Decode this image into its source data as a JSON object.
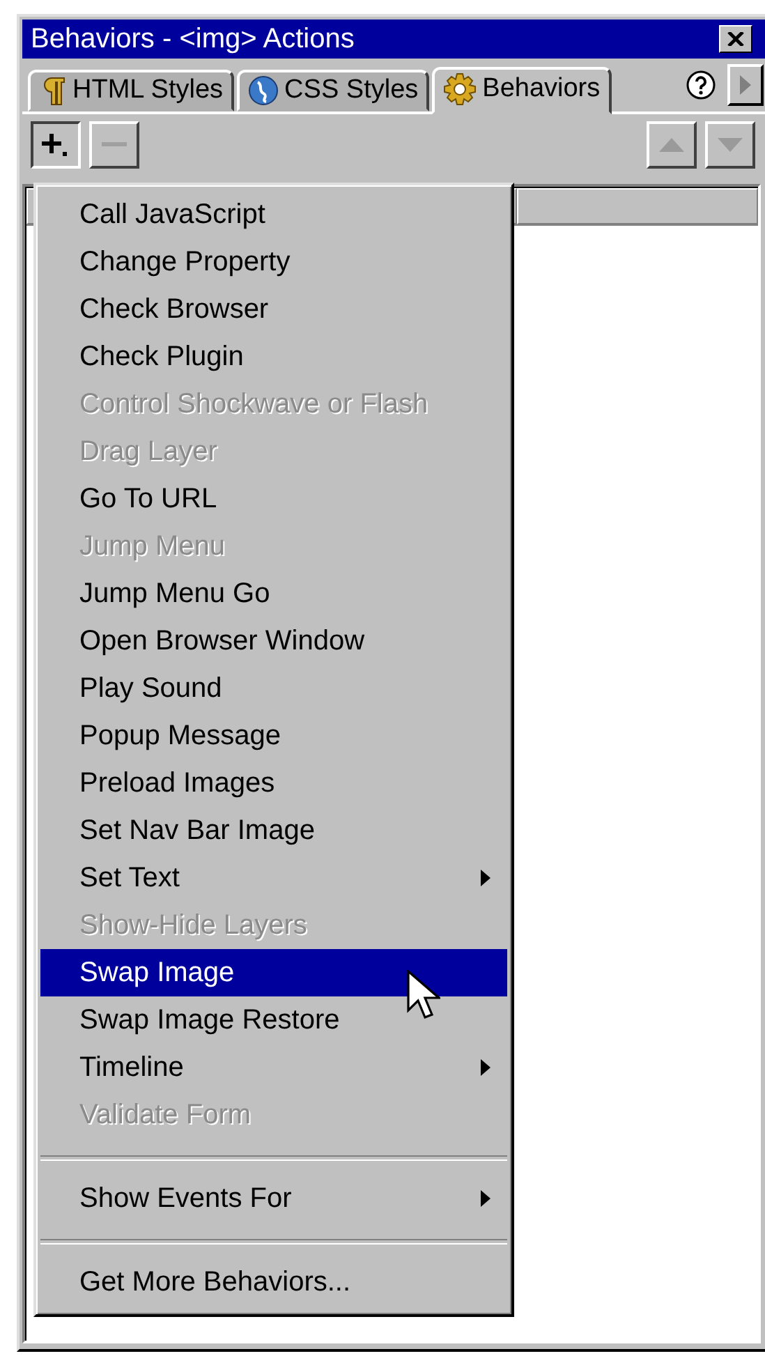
{
  "window": {
    "title": "Behaviors - <img> Actions"
  },
  "tabs": [
    {
      "label": "HTML Styles",
      "selected": false
    },
    {
      "label": "CSS Styles",
      "selected": false
    },
    {
      "label": "Behaviors",
      "selected": true
    }
  ],
  "toolbar": {
    "add": {
      "disabled": false
    },
    "remove": {
      "disabled": true
    },
    "move_up": {
      "disabled": true
    },
    "move_down": {
      "disabled": true
    }
  },
  "menu": {
    "groups": [
      [
        {
          "label": "Call JavaScript",
          "disabled": false,
          "submenu": false,
          "selected": false
        },
        {
          "label": "Change Property",
          "disabled": false,
          "submenu": false,
          "selected": false
        },
        {
          "label": "Check Browser",
          "disabled": false,
          "submenu": false,
          "selected": false
        },
        {
          "label": "Check Plugin",
          "disabled": false,
          "submenu": false,
          "selected": false
        },
        {
          "label": "Control Shockwave or Flash",
          "disabled": true,
          "submenu": false,
          "selected": false
        },
        {
          "label": "Drag Layer",
          "disabled": true,
          "submenu": false,
          "selected": false
        },
        {
          "label": "Go To URL",
          "disabled": false,
          "submenu": false,
          "selected": false
        },
        {
          "label": "Jump Menu",
          "disabled": true,
          "submenu": false,
          "selected": false
        },
        {
          "label": "Jump Menu Go",
          "disabled": false,
          "submenu": false,
          "selected": false
        },
        {
          "label": "Open Browser Window",
          "disabled": false,
          "submenu": false,
          "selected": false
        },
        {
          "label": "Play Sound",
          "disabled": false,
          "submenu": false,
          "selected": false
        },
        {
          "label": "Popup Message",
          "disabled": false,
          "submenu": false,
          "selected": false
        },
        {
          "label": "Preload Images",
          "disabled": false,
          "submenu": false,
          "selected": false
        },
        {
          "label": "Set Nav Bar Image",
          "disabled": false,
          "submenu": false,
          "selected": false
        },
        {
          "label": "Set Text",
          "disabled": false,
          "submenu": true,
          "selected": false
        },
        {
          "label": "Show-Hide Layers",
          "disabled": true,
          "submenu": false,
          "selected": false
        },
        {
          "label": "Swap Image",
          "disabled": false,
          "submenu": false,
          "selected": true
        },
        {
          "label": "Swap Image Restore",
          "disabled": false,
          "submenu": false,
          "selected": false
        },
        {
          "label": "Timeline",
          "disabled": false,
          "submenu": true,
          "selected": false
        },
        {
          "label": "Validate Form",
          "disabled": true,
          "submenu": false,
          "selected": false
        }
      ],
      [
        {
          "label": "Show Events For",
          "disabled": false,
          "submenu": true,
          "selected": false
        }
      ],
      [
        {
          "label": "Get More Behaviors...",
          "disabled": false,
          "submenu": false,
          "selected": false
        }
      ]
    ]
  }
}
